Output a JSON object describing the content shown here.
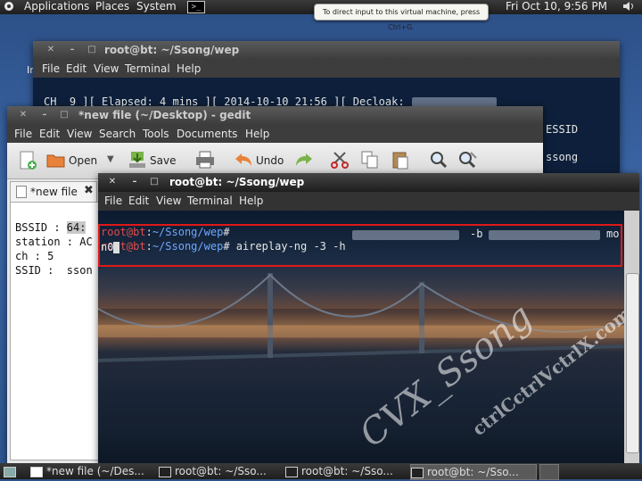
{
  "top_panel": {
    "menus": [
      "Applications",
      "Places",
      "System"
    ],
    "clock": "Fri Oct 10,  9:56 PM",
    "tooltip": "To direct input to this virtual machine, press Ctrl+G."
  },
  "back_terminal": {
    "title": "root@bt: ~/Ssong/wep",
    "menu": [
      "File",
      "Edit",
      "View",
      "Terminal",
      "Help"
    ],
    "status_line_1": "CH  9 ][ Elapsed: 4 mins ][ 2014-10-10 21:56 ][ Decloak:",
    "right_text_1": "ESSID",
    "right_text_2": "ssong"
  },
  "gedit": {
    "title": "*new file (~/Desktop) - gedit",
    "menu": [
      "File",
      "Edit",
      "View",
      "Search",
      "Tools",
      "Documents",
      "Help"
    ],
    "toolbar": {
      "open": "Open",
      "save": "Save",
      "undo": "Undo"
    },
    "tab_label": "*new file",
    "lines": [
      "BSSID : ",
      "station : AC",
      "",
      "ch : 5",
      "SSID :  sson"
    ],
    "bssid_highlight": "64:"
  },
  "front_terminal": {
    "title": "root@bt: ~/Ssong/wep",
    "menu": [
      "File",
      "Edit",
      "View",
      "Terminal",
      "Help"
    ],
    "prompt_user": "root",
    "prompt_host": "bt",
    "prompt_path": "~/Ssong/wep",
    "command": "aireplay-ng -3 -h",
    "flag_b": "-b",
    "tail": "mo",
    "line2": "n0"
  },
  "watermark": {
    "text1": "CVX_Ssong",
    "text2": "ctrlCctrlVctrlX.com"
  },
  "taskbar": {
    "items": [
      "*new file (~/Des...",
      "root@bt: ~/Sso...",
      "root@bt: ~/Sso...",
      "root@bt: ~/Sso..."
    ],
    "active_index": 3
  },
  "colors": {
    "prompt": "#e34c4c",
    "highlight_box": "#e01818",
    "text": "#e6e6e6"
  }
}
